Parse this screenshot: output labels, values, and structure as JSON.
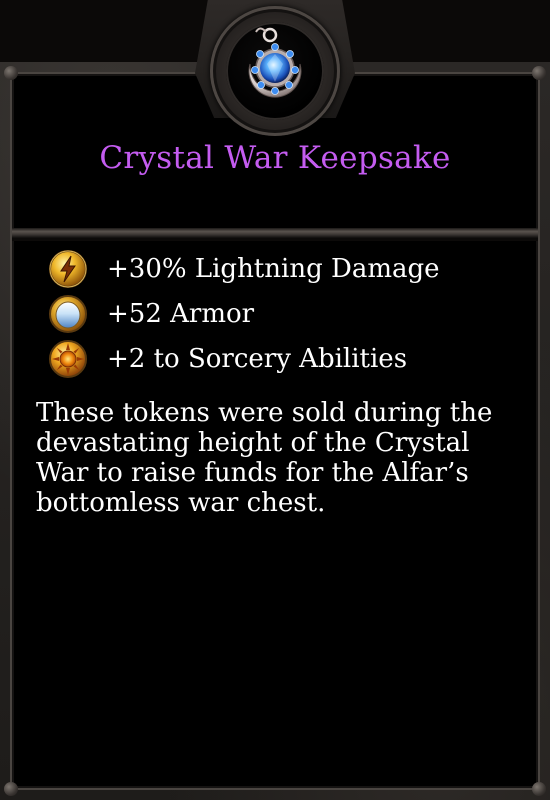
{
  "tooltip": {
    "item_name": "Crystal War Keepsake",
    "item_icon": "amulet-blue-gem-icon",
    "name_color": "#c45cf0",
    "stats": [
      {
        "icon": "lightning-icon",
        "text": "+30% Lightning Damage"
      },
      {
        "icon": "armor-icon",
        "text": "+52 Armor"
      },
      {
        "icon": "sorcery-icon",
        "text": "+2 to Sorcery Abilities"
      }
    ],
    "flavor_text": "These tokens were sold during the devastating height of the Crystal War to raise funds for the Alfar’s bottomless war chest."
  }
}
